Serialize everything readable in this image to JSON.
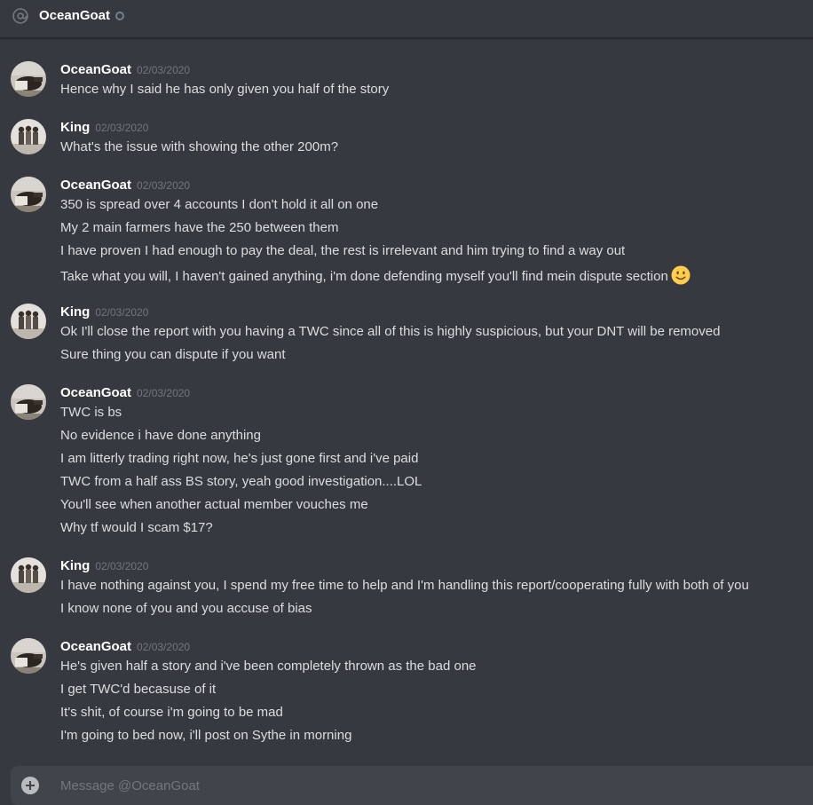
{
  "header": {
    "title": "OceanGoat",
    "icon": "at-icon",
    "status": "offline"
  },
  "colors": {
    "background": "#36393f",
    "author": "#ffffff",
    "text": "#dcddde",
    "timestamp": "#72767d",
    "composer": "#40444b"
  },
  "messages": [
    {
      "author": "OceanGoat",
      "timestamp": "02/03/2020",
      "avatar": "oceangoat-avatar",
      "lines": [
        "Hence why I said he has only given you half of the story"
      ]
    },
    {
      "author": "King",
      "timestamp": "02/03/2020",
      "avatar": "king-avatar",
      "lines": [
        "What's the issue with showing the other 200m?"
      ]
    },
    {
      "author": "OceanGoat",
      "timestamp": "02/03/2020",
      "avatar": "oceangoat-avatar",
      "lines": [
        "350 is spread over 4 accounts I don't hold it all on one",
        "My 2 main farmers have the 250 between them",
        "I have proven I had enough to pay the deal, the rest is irrelevant and him trying to find a way out",
        "Take what you will, I haven't gained anything, i'm done defending myself you'll find mein dispute section"
      ]
    },
    {
      "author": "King",
      "timestamp": "02/03/2020",
      "avatar": "king-avatar",
      "lines": [
        "Ok I'll close the report with you having a TWC since all of this is highly suspicious, but your DNT will be removed",
        "Sure thing you can dispute if you want"
      ]
    },
    {
      "author": "OceanGoat",
      "timestamp": "02/03/2020",
      "avatar": "oceangoat-avatar",
      "lines": [
        "TWC is bs",
        "No evidence i have done anything",
        "I am litterly trading right now, he's just gone first and i've paid",
        "TWC from a half ass BS story, yeah good investigation....LOL",
        "You'll see when another actual member vouches me",
        "Why tf would I scam $17?"
      ]
    },
    {
      "author": "King",
      "timestamp": "02/03/2020",
      "avatar": "king-avatar",
      "lines": [
        "I have nothing against you, I spend my free time to help and I'm handling this report/cooperating fully with both of you",
        "I know none of you and you accuse of bias"
      ]
    },
    {
      "author": "OceanGoat",
      "timestamp": "02/03/2020",
      "avatar": "oceangoat-avatar",
      "lines": [
        "He's given half a story and i've been completely thrown as the bad one",
        "I get TWC'd becasuse of it",
        "It's shit, of course i'm going to be mad",
        "I'm going to bed now, i'll post on Sythe in morning"
      ]
    }
  ],
  "composer": {
    "placeholder": "Message @OceanGoat",
    "value": ""
  }
}
